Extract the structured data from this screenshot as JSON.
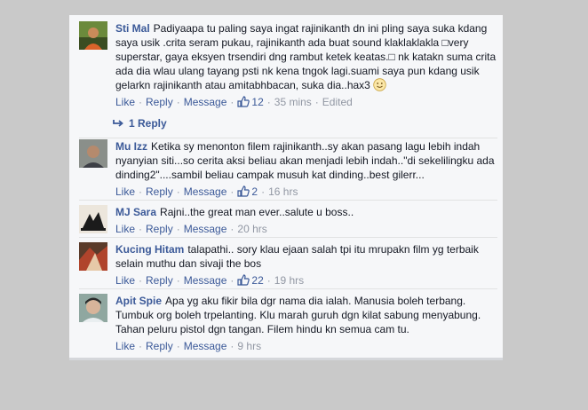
{
  "comments": [
    {
      "name": "Sti Mal",
      "text": "Padiyaapa tu paling saya ingat rajinikanth dn ini pling saya suka kdang saya usik .crita seram pukau, rajinikanth ada buat sound klaklaklakla □very superstar, gaya eksyen trsendiri dng rambut ketek keatas.□ nk katakn suma crita ada dia wlau ulang tayang psti nk kena tngok lagi.suami saya pun kdang usik gelarkn rajinikanth atau amitabhbacan, suka dia..hax3",
      "like": "Like",
      "reply": "Reply",
      "message": "Message",
      "likes": "12",
      "time": "35 mins",
      "edited": "Edited"
    },
    {
      "name": "Mu Izz",
      "text": "Ketika sy menonton filem rajinikanth..sy akan pasang lagu lebih indah nyanyian siti...so cerita aksi beliau akan menjadi lebih indah..\"di sekelilingku ada dinding2\"....sambil beliau campak musuh kat dinding..best gilerr...",
      "like": "Like",
      "reply": "Reply",
      "message": "Message",
      "likes": "2",
      "time": "16 hrs"
    },
    {
      "name": "MJ Sara",
      "text": "Rajni..the great man ever..salute u boss..",
      "like": "Like",
      "reply": "Reply",
      "message": "Message",
      "time": "20 hrs"
    },
    {
      "name": "Kucing Hitam",
      "text": "talapathi.. sory klau ejaan salah tpi itu mrupakn film yg terbaik selain muthu dan sivaji the bos",
      "like": "Like",
      "reply": "Reply",
      "message": "Message",
      "likes": "22",
      "time": "19 hrs"
    },
    {
      "name": "Apit Spie",
      "text": "Apa yg aku fikir bila dgr nama dia ialah. Manusia boleh terbang. Tumbuk org boleh trpelanting. Klu marah guruh dgn kilat sabung menyabung. Tahan peluru pistol dgn tangan. Filem hindu kn semua cam tu.",
      "like": "Like",
      "reply": "Reply",
      "message": "Message",
      "time": "9 hrs"
    }
  ],
  "replies_link": "1 Reply",
  "colors": {
    "link": "#3b5998",
    "meta": "#9197a3",
    "panel": "#f6f7f9",
    "backdrop": "#c9c9c9"
  },
  "icons": {
    "like": "thumbs-up-icon",
    "reply": "reply-arrow-icon",
    "emoji": "smile-emoji-icon"
  }
}
